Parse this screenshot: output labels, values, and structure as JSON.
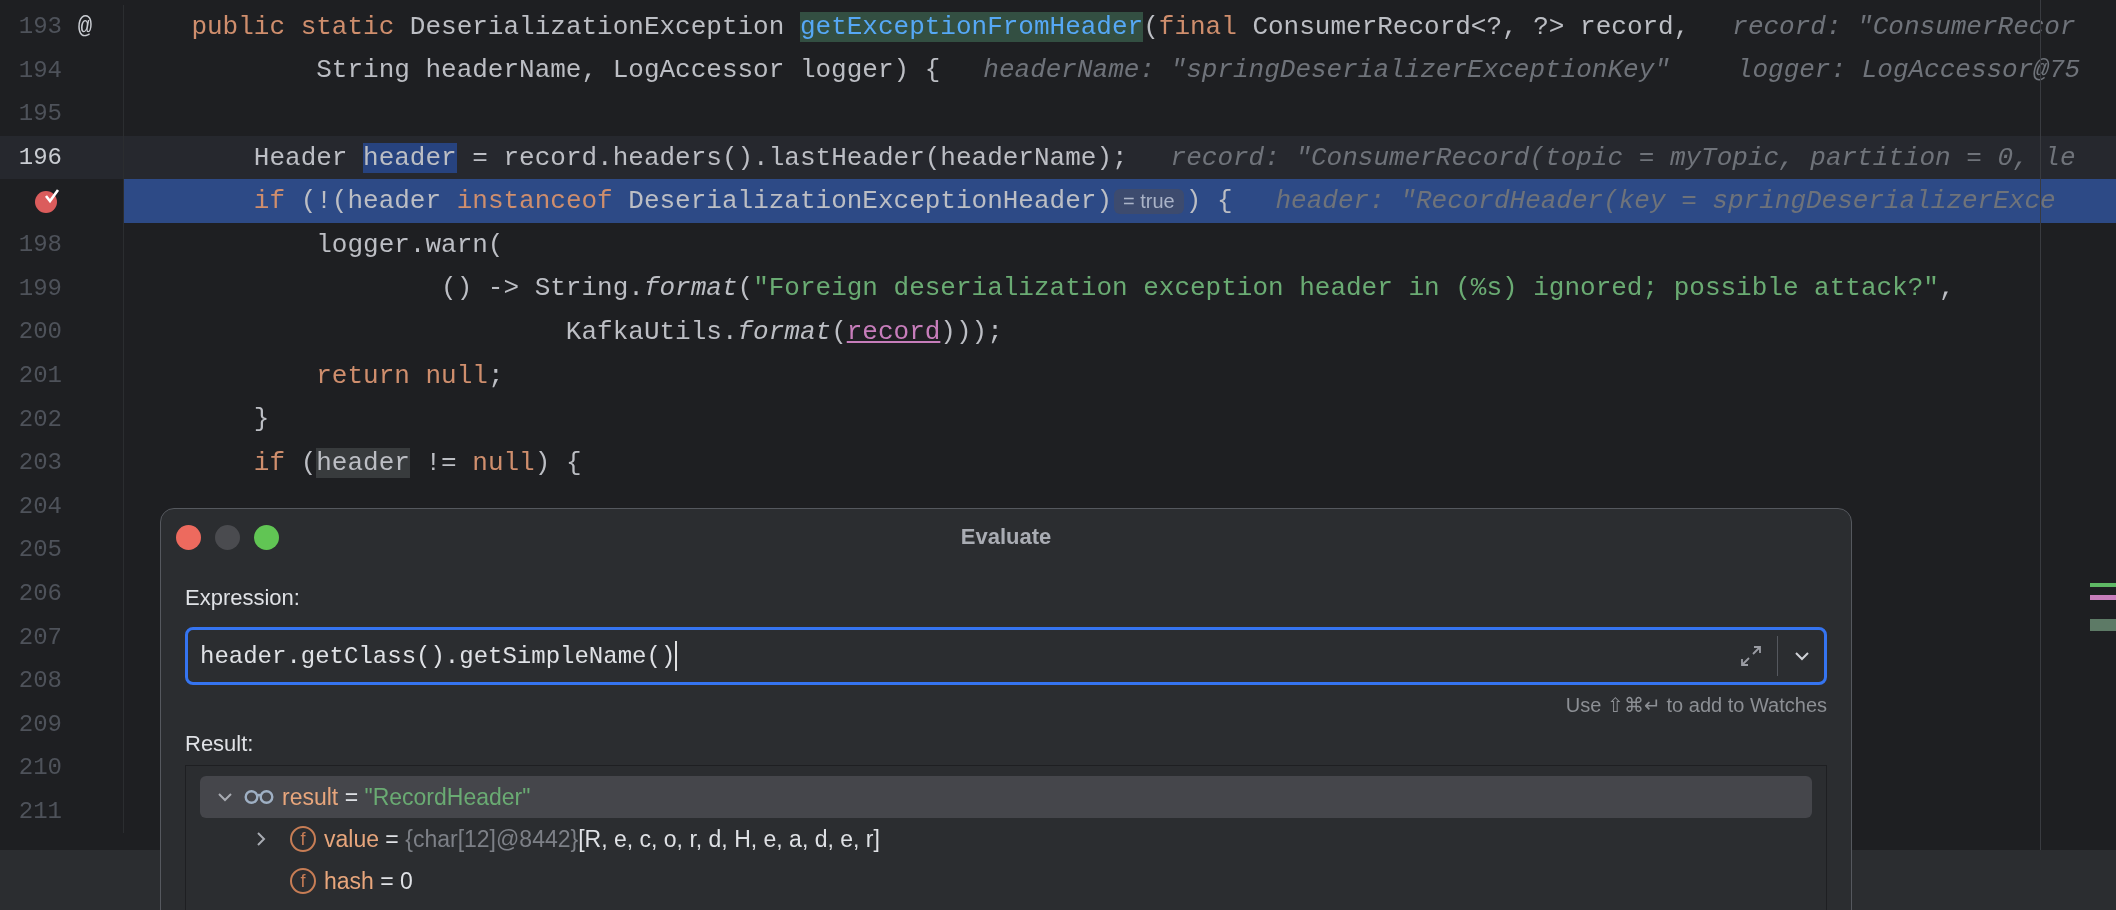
{
  "editor": {
    "lines": [
      {
        "number": "193",
        "gutter_mark": "@",
        "breakpoint": false,
        "caret": false,
        "execution": false,
        "parts": [
          {
            "kind": "code",
            "segments": [
              {
                "kind": "keyword",
                "text": "    public"
              },
              {
                "kind": "keyword",
                "text": " static"
              },
              {
                "kind": "plain",
                "text": " DeserializationException "
              },
              {
                "kind": "declaration",
                "text": "getExceptionFromHeader"
              },
              {
                "kind": "plain",
                "text": "("
              },
              {
                "kind": "keyword",
                "text": "final"
              },
              {
                "kind": "plain",
                "text": " ConsumerRecord<?, ?> record,"
              }
            ]
          },
          {
            "kind": "hint",
            "text": "record: \"ConsumerRecor"
          }
        ]
      },
      {
        "number": "194",
        "breakpoint": false,
        "caret": false,
        "execution": false,
        "parts": [
          {
            "kind": "code",
            "segments": [
              {
                "kind": "plain",
                "text": "            String headerName, LogAccessor logger) {"
              }
            ]
          },
          {
            "kind": "hint",
            "text": "headerName: \"springDeserializerExceptionKey\""
          },
          {
            "kind": "hint",
            "text": "logger: LogAccessor@75"
          }
        ]
      },
      {
        "number": "195",
        "breakpoint": false,
        "caret": false,
        "execution": false
      },
      {
        "number": "196",
        "breakpoint": false,
        "caret": true,
        "execution": false,
        "parts": [
          {
            "kind": "code",
            "segments": [
              {
                "kind": "plain",
                "text": "        Header "
              },
              {
                "kind": "write-usage",
                "text": "header"
              },
              {
                "kind": "plain",
                "text": " = record.headers().lastHeader(headerName);"
              }
            ]
          },
          {
            "kind": "hint",
            "text": "record: \"ConsumerRecord(topic = myTopic, partition = 0, le"
          }
        ]
      },
      {
        "breakpoint": true,
        "caret": false,
        "execution": true,
        "parts": [
          {
            "kind": "code",
            "segments": [
              {
                "kind": "keyword",
                "text": "        if"
              },
              {
                "kind": "plain",
                "text": " (!(header "
              },
              {
                "kind": "keyword",
                "text": "instanceof"
              },
              {
                "kind": "plain",
                "text": " DeserializationExceptionHeader)"
              }
            ]
          },
          {
            "kind": "badge",
            "text": "= true"
          },
          {
            "kind": "code",
            "segments": [
              {
                "kind": "plain",
                "text": ") {"
              }
            ]
          },
          {
            "kind": "hint",
            "text": "header: \"RecordHeader(key = springDeserializerExce"
          }
        ]
      },
      {
        "number": "198",
        "breakpoint": false,
        "caret": false,
        "execution": false,
        "parts": [
          {
            "kind": "code",
            "segments": [
              {
                "kind": "plain",
                "text": "            logger.warn("
              }
            ]
          }
        ]
      },
      {
        "number": "199",
        "breakpoint": false,
        "caret": false,
        "execution": false,
        "parts": [
          {
            "kind": "code",
            "segments": [
              {
                "kind": "plain",
                "text": "                    () -> String."
              },
              {
                "kind": "static-call",
                "text": "format"
              },
              {
                "kind": "plain",
                "text": "("
              },
              {
                "kind": "string",
                "text": "\"Foreign deserialization exception header in (%s) ignored; possible attack?\""
              },
              {
                "kind": "plain",
                "text": ","
              }
            ]
          }
        ]
      },
      {
        "number": "200",
        "breakpoint": false,
        "caret": false,
        "execution": false,
        "parts": [
          {
            "kind": "code",
            "segments": [
              {
                "kind": "plain",
                "text": "                            KafkaUtils."
              },
              {
                "kind": "static-call",
                "text": "format"
              },
              {
                "kind": "plain",
                "text": "("
              },
              {
                "kind": "parameter",
                "text": "record"
              },
              {
                "kind": "plain",
                "text": ")));"
              }
            ]
          }
        ]
      },
      {
        "number": "201",
        "breakpoint": false,
        "caret": false,
        "execution": false,
        "parts": [
          {
            "kind": "code",
            "segments": [
              {
                "kind": "keyword",
                "text": "            return"
              },
              {
                "kind": "keyword",
                "text": " null"
              },
              {
                "kind": "plain",
                "text": ";"
              }
            ]
          }
        ]
      },
      {
        "number": "202",
        "breakpoint": false,
        "caret": false,
        "execution": false,
        "parts": [
          {
            "kind": "code",
            "segments": [
              {
                "kind": "plain",
                "text": "        }"
              }
            ]
          }
        ]
      },
      {
        "number": "203",
        "breakpoint": false,
        "caret": false,
        "execution": false,
        "parts": [
          {
            "kind": "code",
            "segments": [
              {
                "kind": "keyword",
                "text": "        if"
              },
              {
                "kind": "plain",
                "text": " ("
              },
              {
                "kind": "read-usage",
                "text": "header"
              },
              {
                "kind": "plain",
                "text": " != "
              },
              {
                "kind": "keyword",
                "text": "null"
              },
              {
                "kind": "plain",
                "text": ") {"
              }
            ]
          }
        ]
      },
      {
        "number": "204",
        "breakpoint": false,
        "caret": false,
        "execution": false
      },
      {
        "number": "205",
        "breakpoint": false,
        "caret": false,
        "execution": false
      },
      {
        "number": "206",
        "breakpoint": false,
        "caret": false,
        "execution": false
      },
      {
        "number": "207",
        "breakpoint": false,
        "caret": false,
        "execution": false
      },
      {
        "number": "208",
        "breakpoint": false,
        "caret": false,
        "execution": false
      },
      {
        "number": "209",
        "breakpoint": false,
        "caret": false,
        "execution": false
      },
      {
        "number": "210",
        "breakpoint": false,
        "caret": false,
        "execution": false
      },
      {
        "number": "211",
        "breakpoint": false,
        "caret": false,
        "execution": false
      }
    ]
  },
  "dialog": {
    "title": "Evaluate",
    "expression_label": "Expression:",
    "expression": "header.getClass().getSimpleName()",
    "watches_hint": "Use ⇧⌘↵ to add to Watches",
    "result_label": "Result:",
    "result_tree": [
      {
        "kind": "watch",
        "name": "result",
        "separator": "=",
        "value": {
          "kind": "string",
          "text": "\"RecordHeader\""
        },
        "expanded": true,
        "selected": true,
        "children": [
          {
            "kind": "field",
            "icon_letter": "f",
            "name": "value",
            "separator": "=",
            "type_label": "{char[12]@8442}",
            "value": {
              "kind": "plain",
              "text": "[R, e, c, o, r, d, H, e, a, d, e, r]"
            },
            "expanded": false,
            "selected": false
          },
          {
            "kind": "field",
            "icon_letter": "f",
            "name": "hash",
            "separator": "=",
            "value": {
              "kind": "plain",
              "text": "0"
            },
            "selected": false
          }
        ]
      }
    ]
  }
}
